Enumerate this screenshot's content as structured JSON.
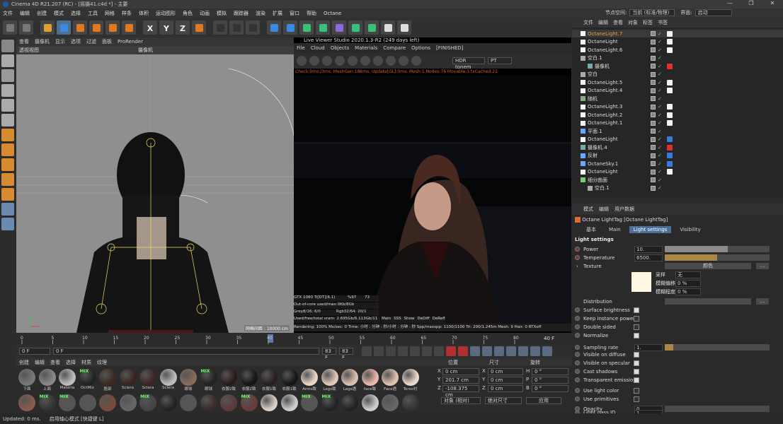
{
  "app": {
    "title": "Cinema 4D R21.207 (RC) - [摇摄41.c4d *] - 主要",
    "window_buttons": [
      "—",
      "❐",
      "✕"
    ]
  },
  "menubar": {
    "items": [
      "文件",
      "编辑",
      "创建",
      "模式",
      "选择",
      "工具",
      "网格",
      "样条",
      "体积",
      "运动图形",
      "角色",
      "动画",
      "模拟",
      "跟踪器",
      "渲染",
      "扩展",
      "窗口",
      "帮助",
      "Octane"
    ],
    "node_space_label": "节点空间:",
    "node_space_value": "当前 (标准/物理)",
    "layout_label": "界面:",
    "layout_value": "启动"
  },
  "toolbar": {
    "icons": [
      "undo-icon",
      "redo-icon",
      "live-select-icon",
      "move-icon",
      "scale-icon",
      "rotate-icon",
      "recent-tool-icon",
      "add-icon",
      "x-axis-icon",
      "y-axis-icon",
      "z-axis-icon",
      "coord-system-icon",
      "render-region-icon",
      "render-view-icon",
      "render-settings-icon",
      "cube-icon",
      "pen-icon",
      "subdivision-icon",
      "cloner-icon",
      "deformer-icon",
      "field-icon",
      "sky-icon",
      "camera-icon",
      "light-icon"
    ],
    "axis_labels": [
      "X",
      "Y",
      "Z"
    ]
  },
  "viewport": {
    "menu": [
      "查看",
      "摄像机",
      "显示",
      "选项",
      "过滤",
      "面板",
      "ProRender"
    ],
    "view_name": "透视视图",
    "camera_label": "摄像机",
    "grid_label": "网格间距 : 10000 cm"
  },
  "live_viewer": {
    "title": "Live Viewer Studio 2020.1.3-R2 (249 days left)",
    "menu": [
      "File",
      "Cloud",
      "Objects",
      "Materials",
      "Compare",
      "Options",
      "[FINISHED]"
    ],
    "tonemap": "HDR tonem",
    "kernel": "PT",
    "status": "Check:0ms./3ms. MeshGen:186ms. Update[GL]:0ms. Mesh:1 Nodes:76 Movable:3 txCached:21",
    "gpu_name": "GTX 1080 Ti[DT](6.1)",
    "gpu_pct": "%97",
    "gpu_temp": "73",
    "out_of_core": "Out-of-core used/max:0Kb/8Gb",
    "grey": "Grey8/16: 6/0",
    "rgb": "Rgb32/64: 20/1",
    "vram": "Used/free/total vram: 2.695Gb/6.113Gb/11",
    "tabs": [
      "Main",
      "SSS",
      "Show",
      "DeDiff",
      "DeRefl"
    ],
    "render_line": "Rendering: 100%  Ms/sec: 0   Time: 小时 : 分钟 : 秒/小时 : 分钟 : 秒   Spp/maxspp: 1100/1100  Tri: 200/1.245m  Mesh: 9   Hair: 0   RTXoff"
  },
  "timeline": {
    "ticks": [
      "0",
      "5",
      "10",
      "15",
      "20",
      "25",
      "30",
      "35",
      "40",
      "45",
      "50",
      "55",
      "60",
      "65",
      "70",
      "75",
      "80"
    ],
    "frame_end_label": "40 F"
  },
  "playbar": {
    "start": "0 F",
    "current": "0 F",
    "end": "83 F",
    "end2": "83 F"
  },
  "materials": {
    "menu": [
      "创建",
      "编辑",
      "查看",
      "选择",
      "材质",
      "纹理"
    ],
    "row1": [
      {
        "label": "下面",
        "color": "#777"
      },
      {
        "label": "上面",
        "color": "#888"
      },
      {
        "label": "Materia",
        "color": "#bbb"
      },
      {
        "label": "OctMix",
        "color": "#222",
        "mix": true
      },
      {
        "label": "脸部",
        "color": "#3a2a22"
      },
      {
        "label": "Sclera",
        "color": "#3a2420"
      },
      {
        "label": "Sclera",
        "color": "#3b2622"
      },
      {
        "label": "Sclera",
        "color": "#bbb"
      },
      {
        "label": "眼球",
        "color": "#8a6a5a"
      },
      {
        "label": "眼球",
        "color": "#222",
        "mix": true
      },
      {
        "label": "衣服2致",
        "color": "#2a1a1a"
      },
      {
        "label": "衣服2致",
        "color": "#151515"
      },
      {
        "label": "衣服1致",
        "color": "#282020"
      },
      {
        "label": "衣服1致",
        "color": "#161616"
      },
      {
        "label": "Arms致",
        "color": "#e8d5c8"
      },
      {
        "label": "Legs致",
        "color": "#e0c8b8"
      },
      {
        "label": "Legs透",
        "color": "#d8c0b0"
      },
      {
        "label": "face致",
        "color": "#e8b8a8"
      },
      {
        "label": "Face透",
        "color": "#e0c0b0"
      },
      {
        "label": "Torso衬",
        "color": "#ead8c8"
      }
    ],
    "row2": [
      {
        "color": "#8a5a4a"
      },
      {
        "color": "#333",
        "mix": true
      },
      {
        "color": "#555",
        "mix": true
      },
      {
        "color": "#555"
      },
      {
        "color": "#7a4a3a"
      },
      {
        "color": "#666"
      },
      {
        "color": "#444",
        "mix": true
      },
      {
        "color": "#222"
      },
      {
        "color": "#555"
      },
      {
        "color": "#3a2a2a"
      },
      {
        "color": "#5a3a3a"
      },
      {
        "color": "#6a3a3a",
        "mix": true
      },
      {
        "color": "#d8d0c8"
      },
      {
        "color": "#ccc"
      },
      {
        "color": "#555",
        "mix": true
      },
      {
        "color": "#222",
        "mix": true
      },
      {
        "color": "#222"
      },
      {
        "color": "#ccc"
      },
      {
        "color": "#666"
      },
      {
        "color": "#333"
      }
    ]
  },
  "coords": {
    "headers": [
      "位置",
      "尺寸",
      "旋转"
    ],
    "rows": [
      {
        "axis": "X",
        "pos": "0 cm",
        "saxis": "X",
        "size": "0 cm",
        "raxis": "H",
        "rot": "0 °"
      },
      {
        "axis": "Y",
        "pos": "201.7 cm",
        "saxis": "Y",
        "size": "0 cm",
        "raxis": "P",
        "rot": "0 °"
      },
      {
        "axis": "Z",
        "pos": "-108.375 cm",
        "saxis": "Z",
        "size": "0 cm",
        "raxis": "B",
        "rot": "0 °"
      }
    ],
    "mode": "对象 (相对)",
    "size_mode": "绝对尺寸",
    "apply": "应用"
  },
  "object_manager": {
    "menu": [
      "文件",
      "编辑",
      "查看",
      "对象",
      "标签",
      "书签"
    ],
    "objects": [
      {
        "name": "OctaneLight.7",
        "icon": "light",
        "tag": "#f4f4f4",
        "sel": true
      },
      {
        "name": "OctaneLight",
        "icon": "light",
        "tag": "#f4f4f4"
      },
      {
        "name": "OctaneLight.6",
        "icon": "light",
        "tag": "#f4f4f4"
      },
      {
        "name": "空白.1",
        "icon": "null",
        "tag": ""
      },
      {
        "name": "摄像机",
        "icon": "camera",
        "tag": "#e03030",
        "indent": 1
      },
      {
        "name": "空白",
        "icon": "null",
        "tag": ""
      },
      {
        "name": "OctaneLight.5",
        "icon": "light",
        "tag": "#f4f4f4"
      },
      {
        "name": "OctaneLight.4",
        "icon": "light",
        "tag": "#f4f4f4"
      },
      {
        "name": "随机",
        "icon": "random",
        "tag": ""
      },
      {
        "name": "OctaneLight.3",
        "icon": "light",
        "tag": "#f4f4f4"
      },
      {
        "name": "OctaneLight.2",
        "icon": "light",
        "tag": "#f4f4f4"
      },
      {
        "name": "OctaneLight.1",
        "icon": "light",
        "tag": "#f4f4f4"
      },
      {
        "name": "平面.1",
        "icon": "plane",
        "tag": ""
      },
      {
        "name": "OctaneLight",
        "icon": "light",
        "tag": "#3a7ae0"
      },
      {
        "name": "摄像机.4",
        "icon": "camera",
        "tag": "#e03030"
      },
      {
        "name": "反射",
        "icon": "sphere",
        "tag": "#3a7ae0"
      },
      {
        "name": "OctaneSky.1",
        "icon": "sky",
        "tag": "#3a7ae0"
      },
      {
        "name": "OctaneLight",
        "icon": "light",
        "tag": "#f4f4f4"
      },
      {
        "name": "细分曲面",
        "icon": "subd",
        "tag": ""
      },
      {
        "name": "空白.1",
        "icon": "null",
        "tag": "",
        "indent": 1
      }
    ]
  },
  "attributes": {
    "menu": [
      "模式",
      "编辑",
      "用户数据"
    ],
    "object_title": "Octane LightTag [Octane LightTag]",
    "tabs": [
      "基本",
      "Main",
      "Light settings",
      "Visibility"
    ],
    "active_tab": "Light settings",
    "section": "Light settings",
    "power_label": "Power",
    "power": "10.",
    "power_fill": 0.6,
    "temp_label": "Temperature",
    "temp": "6500.",
    "temp_fill": 0.5,
    "texture_label": "Texture",
    "texture_value": "颜色",
    "sampling_label": "采样",
    "sampling_value": "无",
    "blur_offset_label": "模糊偏移",
    "blur_offset": "0 %",
    "blur_degree_label": "模糊程度",
    "blur_degree": "0 %",
    "distribution_label": "Distribution",
    "surface_brightness": "Surface brightness",
    "keep_instance_power": "Keep instance power",
    "double_sided": "Double sided",
    "normalize": "Normalize",
    "sampling_rate_label": "Sampling rate",
    "sampling_rate": "1.",
    "visible_on_diffuse": "Visible on diffuse",
    "visible_on_specular": "Visible on specular",
    "cast_shadows": "Cast shadows",
    "transparent_emission": "Transparent emission",
    "use_light_color": "Use light color",
    "use_primitives": "Use primitives",
    "opacity_label": "Opacity",
    "opacity": "0",
    "light_pass_id_label": "Light pass ID",
    "light_pass_id": "1"
  },
  "status": {
    "text": "Updated: 0 ms.",
    "hint": "启用轴心模式 [快捷键 L]"
  }
}
